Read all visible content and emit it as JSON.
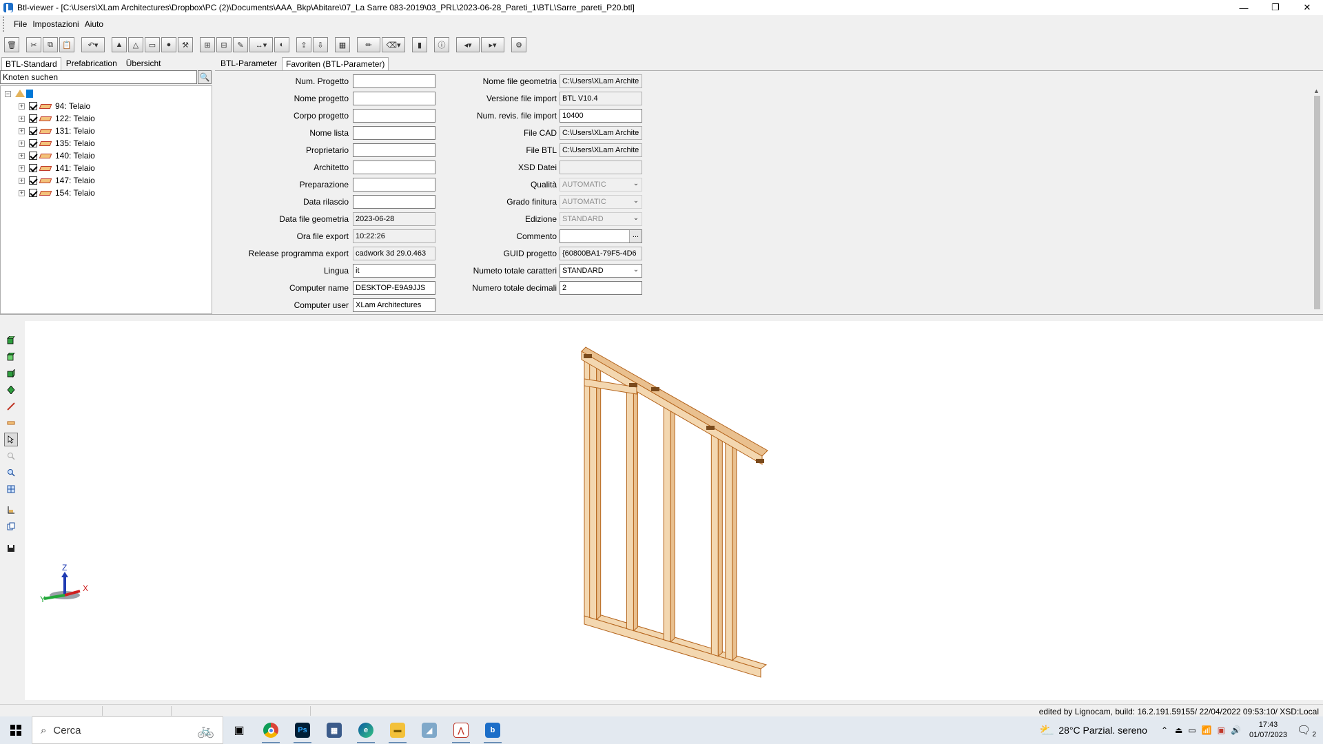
{
  "window": {
    "title": "Btl-viewer - [C:\\Users\\XLam Architectures\\Dropbox\\PC (2)\\Documents\\AAA_Bkp\\Abitare\\07_La Sarre 083-2019\\03_PRL\\2023-06-28_Pareti_1\\BTL\\Sarre_pareti_P20.btl]",
    "minimize": "—",
    "restore": "❐",
    "close": "✕"
  },
  "menu": {
    "file": "File",
    "impostazioni": "Impostazioni",
    "aiuto": "Aiuto"
  },
  "left_tabs": [
    "BTL-Standard",
    "Prefabrication",
    "Übersicht"
  ],
  "search": {
    "value": "Knoten suchen",
    "icon": "search-icon"
  },
  "tree": {
    "items": [
      {
        "label": "94: Telaio"
      },
      {
        "label": "122: Telaio"
      },
      {
        "label": "131: Telaio"
      },
      {
        "label": "135: Telaio"
      },
      {
        "label": "140: Telaio"
      },
      {
        "label": "141: Telaio"
      },
      {
        "label": "147: Telaio"
      },
      {
        "label": "154: Telaio"
      }
    ]
  },
  "param_tabs": [
    "BTL-Parameter",
    "Favoriten (BTL-Parameter)"
  ],
  "params_left": [
    {
      "label": "Num. Progetto",
      "value": "",
      "state": "edit"
    },
    {
      "label": "Nome progetto",
      "value": "",
      "state": "edit"
    },
    {
      "label": "Corpo progetto",
      "value": "",
      "state": "edit"
    },
    {
      "label": "Nome lista",
      "value": "",
      "state": "edit"
    },
    {
      "label": "Proprietario",
      "value": "",
      "state": "edit"
    },
    {
      "label": "Architetto",
      "value": "",
      "state": "edit"
    },
    {
      "label": "Preparazione",
      "value": "",
      "state": "edit"
    },
    {
      "label": "Data rilascio",
      "value": "",
      "state": "edit"
    },
    {
      "label": "Data file geometria",
      "value": "2023-06-28",
      "state": "ro"
    },
    {
      "label": "Ora file export",
      "value": "10:22:26",
      "state": "ro"
    },
    {
      "label": "Release programma export",
      "value": "cadwork 3d 29.0.463",
      "state": "ro"
    },
    {
      "label": "Lingua",
      "value": "it",
      "state": "edit"
    },
    {
      "label": "Computer name",
      "value": "DESKTOP-E9A9JJS",
      "state": "edit"
    },
    {
      "label": "Computer user",
      "value": "XLam Architectures",
      "state": "edit"
    }
  ],
  "params_right": [
    {
      "label": "Nome file geometria",
      "value": "C:\\Users\\XLam Archite",
      "state": "ro"
    },
    {
      "label": "Versione file import",
      "value": "BTL V10.4",
      "state": "ro"
    },
    {
      "label": "Num. revis. file import",
      "value": "10400",
      "state": "edit"
    },
    {
      "label": "File CAD",
      "value": "C:\\Users\\XLam Archite",
      "state": "ro"
    },
    {
      "label": "File BTL",
      "value": "C:\\Users\\XLam Archite",
      "state": "ro"
    },
    {
      "label": "XSD Datei",
      "value": "",
      "state": "ro"
    },
    {
      "label": "Qualità",
      "value": "AUTOMATIC",
      "state": "dis",
      "dropdown": true
    },
    {
      "label": "Grado finitura",
      "value": "AUTOMATIC",
      "state": "dis",
      "dropdown": true
    },
    {
      "label": "Edizione",
      "value": "STANDARD",
      "state": "dis",
      "dropdown": true
    },
    {
      "label": "Commento",
      "value": "",
      "state": "edit",
      "ellipsis": "..."
    },
    {
      "label": "GUID progetto",
      "value": "{60800BA1-79F5-4D6",
      "state": "ro"
    },
    {
      "label": "Numeto totale caratteri",
      "value": "STANDARD",
      "state": "edit",
      "dropdown": true
    },
    {
      "label": "Numero totale decimali",
      "value": "2",
      "state": "edit"
    }
  ],
  "axes": {
    "x": "X",
    "y": "Y",
    "z": "Z"
  },
  "colors": {
    "beam_fill": "#f3d7b0",
    "beam_edge": "#b5651d",
    "beam_end": "#7a4a1c"
  },
  "status": {
    "text": "edited by Lignocam, build: 16.2.191.59155/ 22/04/2022 09:53:10/ XSD:Local"
  },
  "taskbar": {
    "search_placeholder": "Cerca",
    "weather": "28°C  Parzial. sereno",
    "time": "17:43",
    "date": "01/07/2023",
    "notifications": "2"
  }
}
